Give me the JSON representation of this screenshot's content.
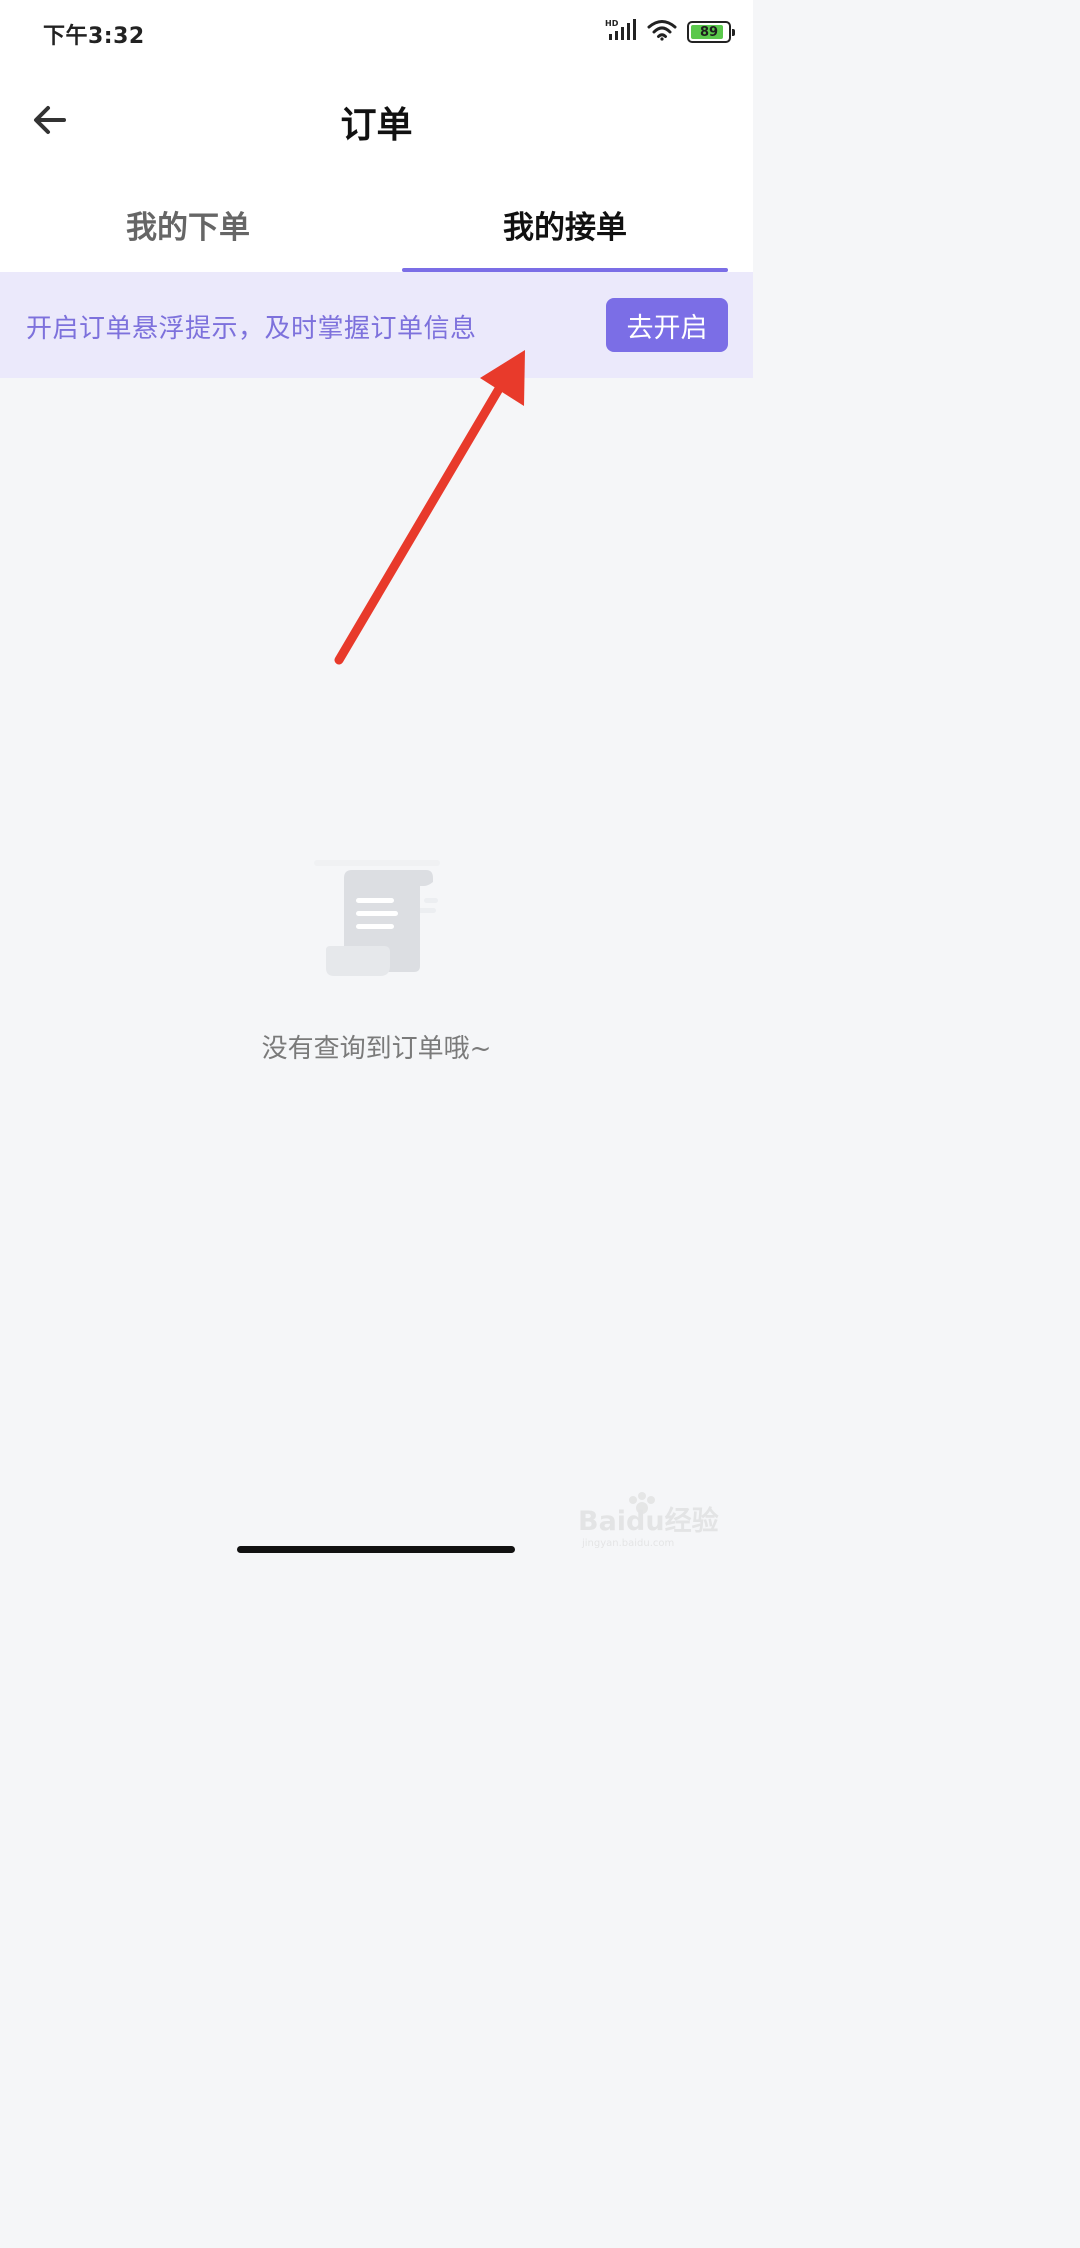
{
  "status_bar": {
    "time": "下午3:32",
    "network_badge": "HD",
    "battery_percent": 89,
    "battery_label": "89",
    "battery_fill_color": "#5ac84c"
  },
  "nav": {
    "back_icon": "arrow-left-icon",
    "title": "订单"
  },
  "tabs": [
    {
      "label": "我的下单",
      "active": false
    },
    {
      "label": "我的接单",
      "active": true
    }
  ],
  "notice": {
    "text": "开启订单悬浮提示，及时掌握订单信息",
    "button_label": "去开启"
  },
  "empty_state": {
    "icon": "scroll-document-icon",
    "message": "没有查询到订单哦~"
  },
  "watermark": {
    "brand": "Baidu经验",
    "site": "jingyan.baidu.com"
  },
  "colors": {
    "accent": "#7b6ee6",
    "notice_background": "#ebe9fb",
    "page_background": "#f5f6f8",
    "annotation_arrow": "#e83a2b"
  }
}
